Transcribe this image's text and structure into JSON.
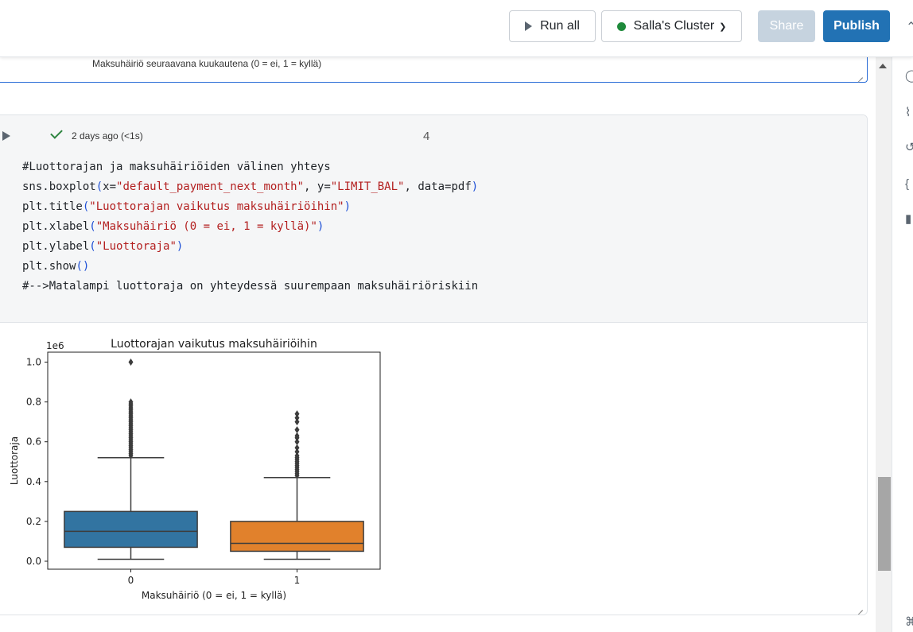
{
  "toolbar": {
    "run_all_label": "Run all",
    "cluster_label": "Salla's Cluster",
    "share_label": "Share",
    "publish_label": "Publish"
  },
  "previous_cell": {
    "output_caption": "Maksuhäiriö seuraavana kuukautena (0 = ei, 1 = kyllä)"
  },
  "cell": {
    "status": "2 days ago (<1s)",
    "number": "4",
    "code_lines": [
      "#Luottorajan ja maksuhäiriöiden välinen yhteys",
      "sns.boxplot(x=\"default_payment_next_month\", y=\"LIMIT_BAL\", data=pdf)",
      "plt.title(\"Luottorajan vaikutus maksuhäiriöihin\")",
      "plt.xlabel(\"Maksuhäiriö (0 = ei, 1 = kyllä)\")",
      "plt.ylabel(\"Luottoraja\")",
      "plt.show()",
      "#-->Matalampi luottoraja on yhteydessä suurempaan maksuhäiriöriskiin"
    ]
  },
  "chart_data": {
    "type": "boxplot",
    "title": "Luottorajan vaikutus maksuhäiriöihin",
    "xlabel": "Maksuhäiriö (0 = ei, 1 = kyllä)",
    "ylabel": "Luottoraja",
    "y_offset_label": "1e6",
    "categories": [
      "0",
      "1"
    ],
    "yticks": [
      "0.0",
      "0.2",
      "0.4",
      "0.6",
      "0.8",
      "1.0"
    ],
    "ylim": [
      -0.04,
      1.05
    ],
    "colors": [
      "#3274a1",
      "#e1812c"
    ],
    "boxes": [
      {
        "category": "0",
        "whisker_low": 0.01,
        "q1": 0.07,
        "median": 0.15,
        "q3": 0.25,
        "whisker_high": 0.52,
        "outliers": [
          0.53,
          0.54,
          0.55,
          0.56,
          0.57,
          0.58,
          0.59,
          0.6,
          0.61,
          0.62,
          0.63,
          0.64,
          0.65,
          0.66,
          0.67,
          0.68,
          0.69,
          0.7,
          0.71,
          0.72,
          0.73,
          0.74,
          0.75,
          0.76,
          0.77,
          0.78,
          0.79,
          0.8,
          1.0
        ]
      },
      {
        "category": "1",
        "whisker_low": 0.01,
        "q1": 0.05,
        "median": 0.09,
        "q3": 0.2,
        "whisker_high": 0.42,
        "outliers": [
          0.43,
          0.44,
          0.45,
          0.46,
          0.47,
          0.48,
          0.49,
          0.5,
          0.51,
          0.52,
          0.53,
          0.55,
          0.57,
          0.6,
          0.62,
          0.63,
          0.66,
          0.7,
          0.72,
          0.74
        ]
      }
    ]
  },
  "icons": {
    "rail": [
      "comment-icon",
      "flask-icon",
      "history-icon",
      "variables-icon",
      "chart-icon",
      "shortcut-icon"
    ]
  }
}
